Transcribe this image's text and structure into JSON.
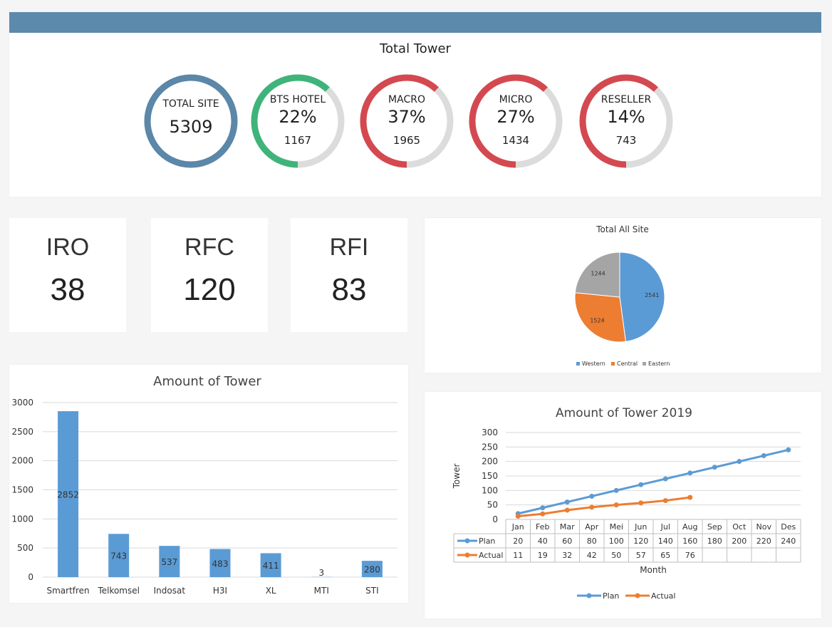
{
  "total_tower": {
    "title": "Total Tower",
    "rings": [
      {
        "label": "TOTAL SITE",
        "pct": "",
        "value": "5309",
        "fraction": 1.0,
        "color": "#5b87a8"
      },
      {
        "label": "BTS HOTEL",
        "pct": "22%",
        "value": "1167",
        "fraction": 0.62,
        "color": "#3fb47a"
      },
      {
        "label": "MACRO",
        "pct": "37%",
        "value": "1965",
        "fraction": 0.62,
        "color": "#d44950"
      },
      {
        "label": "MICRO",
        "pct": "27%",
        "value": "1434",
        "fraction": 0.62,
        "color": "#d44950"
      },
      {
        "label": "RESELLER",
        "pct": "14%",
        "value": "743",
        "fraction": 0.62,
        "color": "#d44950"
      }
    ]
  },
  "kpis": [
    {
      "label": "IRO",
      "value": "38"
    },
    {
      "label": "RFC",
      "value": "120"
    },
    {
      "label": "RFI",
      "value": "83"
    }
  ],
  "chart_data": [
    {
      "type": "pie",
      "title": "Total All Site",
      "categories": [
        "Western",
        "Central",
        "Eastern"
      ],
      "values": [
        2541,
        1524,
        1244
      ],
      "colors": [
        "#5b9bd5",
        "#ed7d31",
        "#a5a5a5"
      ],
      "legend": "bottom"
    },
    {
      "type": "bar",
      "title": "Amount of Tower",
      "categories": [
        "Smartfren",
        "Telkomsel",
        "Indosat",
        "H3I",
        "XL",
        "MTI",
        "STI"
      ],
      "values": [
        2852,
        743,
        537,
        483,
        411,
        3,
        280
      ],
      "ylim": [
        0,
        3000
      ],
      "yticks": [
        "0",
        "500",
        "1000",
        "1500",
        "2000",
        "2500",
        "3000"
      ],
      "color": "#5b9bd5",
      "grid": true
    },
    {
      "type": "line",
      "title": "Amount of Tower 2019",
      "xlabel": "Month",
      "ylabel": "Tower",
      "categories": [
        "Jan",
        "Feb",
        "Mar",
        "Apr",
        "Mei",
        "Jun",
        "Jul",
        "Aug",
        "Sep",
        "Oct",
        "Nov",
        "Des"
      ],
      "ylim": [
        0,
        300
      ],
      "yticks": [
        "0",
        "50",
        "100",
        "150",
        "200",
        "250",
        "300"
      ],
      "series": [
        {
          "name": "Plan",
          "color": "#5b9bd5",
          "values": [
            20,
            40,
            60,
            80,
            100,
            120,
            140,
            160,
            180,
            200,
            220,
            240
          ]
        },
        {
          "name": "Actual",
          "color": "#ed7d31",
          "values": [
            11,
            19,
            32,
            42,
            50,
            57,
            65,
            76,
            null,
            null,
            null,
            null
          ]
        }
      ],
      "table": true,
      "legend": "bottom",
      "grid": true
    }
  ]
}
